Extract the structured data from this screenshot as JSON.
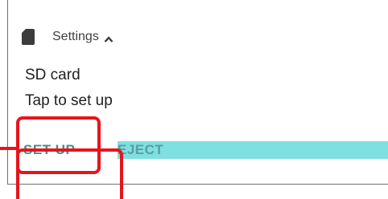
{
  "notification": {
    "app_label": "Settings",
    "icon": "sd-card-icon",
    "expand_icon": "chevron-up-icon",
    "title": "SD card",
    "text": "Tap to set up",
    "actions": [
      {
        "label": "SET UP"
      },
      {
        "label": "EJECT"
      }
    ]
  },
  "colors": {
    "highlight": "#7fdfe1",
    "callout": "#e8141c",
    "action_text": "#4a8a8c"
  }
}
